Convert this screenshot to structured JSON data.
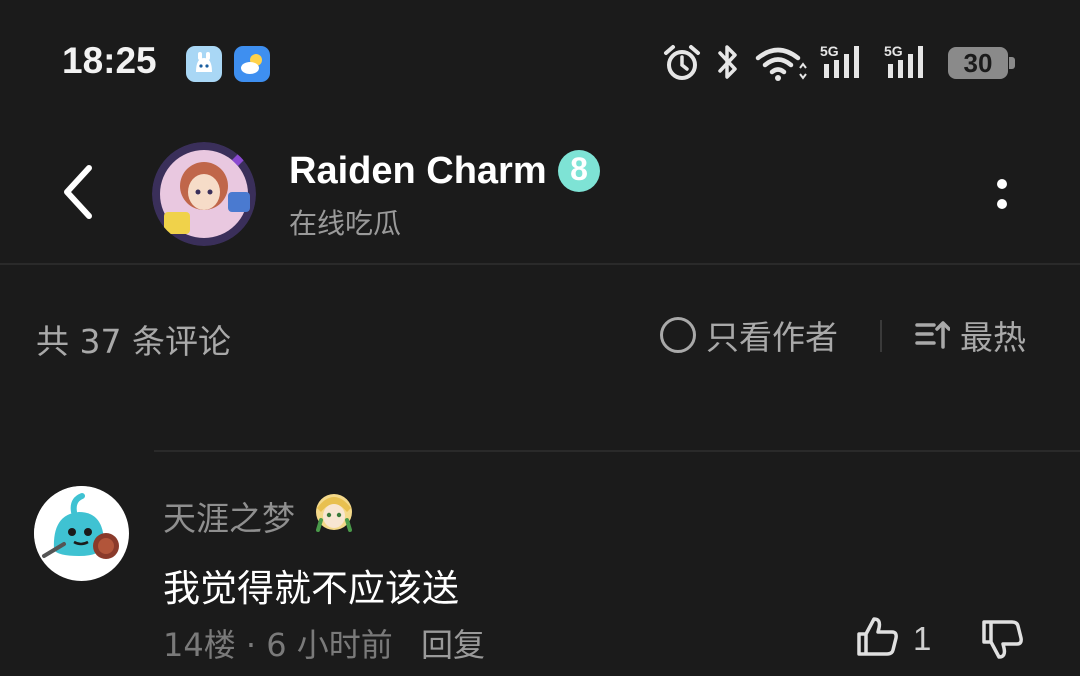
{
  "status_bar": {
    "time": "18:25",
    "icons": [
      "alarm-icon",
      "bluetooth-icon",
      "wifi-icon",
      "signal-5g-icon",
      "signal-5g-icon-2"
    ],
    "battery": "30"
  },
  "header": {
    "title": "Raiden Charm",
    "level": "8",
    "subtitle": "在线吃瓜",
    "level_color": "#7ee3d5"
  },
  "comment_bar": {
    "count_text": "共 37 条评论",
    "author_only": "只看作者",
    "sort": "最热"
  },
  "comment": {
    "username": "天涯之梦",
    "text": "我觉得就不应该送",
    "floor_time": "14楼 · 6 小时前",
    "reply": "回复",
    "likes": "1"
  },
  "colors": {
    "background": "#1b1b1b",
    "text_primary": "#ffffff",
    "text_secondary": "#a9a9a9"
  }
}
